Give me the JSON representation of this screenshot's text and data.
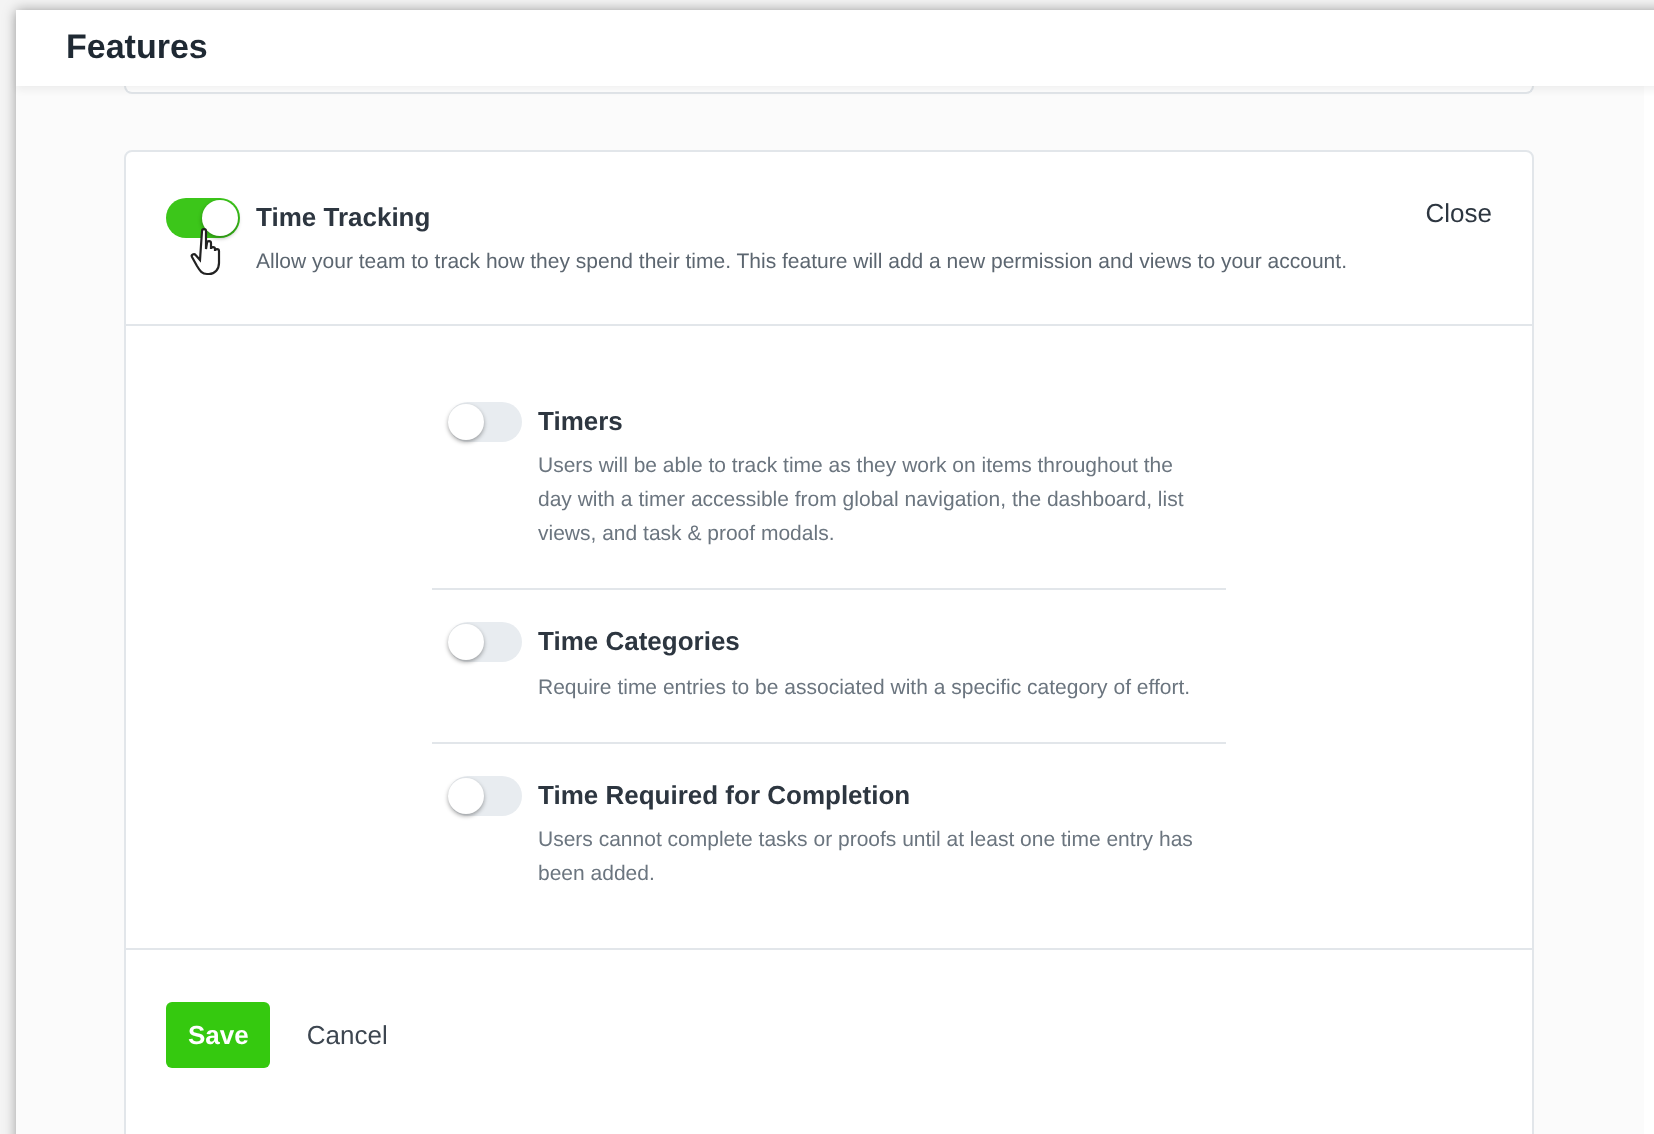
{
  "window": {
    "title": "Features"
  },
  "feature": {
    "title": "Time Tracking",
    "on": true,
    "description": "Allow your team to track how they spend their time. This feature will add a new permission and views to your account.",
    "close": "Close"
  },
  "options": [
    {
      "title": "Timers",
      "on": false,
      "description": "Users will be able to track time as they work on items throughout the day with a timer accessible from global navigation, the dashboard, list views, and task & proof modals."
    },
    {
      "title": "Time Categories",
      "on": false,
      "description": "Require time entries to be associated with a specific category of effort."
    },
    {
      "title": "Time Required for Completion",
      "on": false,
      "description": "Users cannot complete tasks or proofs until at least one time entry has been added."
    }
  ],
  "buttons": {
    "save": "Save",
    "cancel": "Cancel"
  }
}
